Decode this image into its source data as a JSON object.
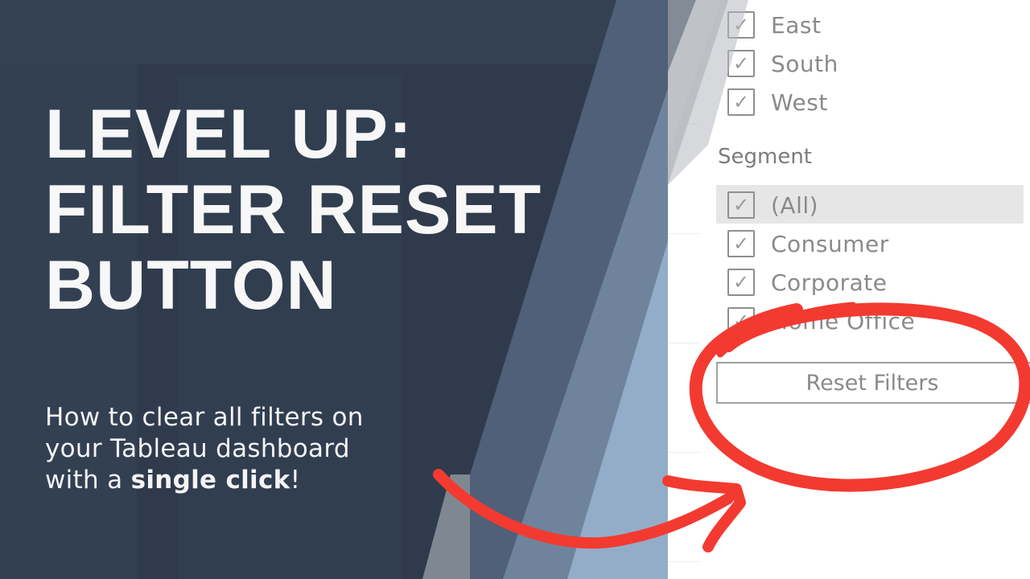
{
  "headline": {
    "lines": [
      "LEVEL UP:",
      "FILTER RESET",
      "BUTTON"
    ]
  },
  "subtitle": {
    "line1": "How to clear all filters on",
    "line2": "your Tableau dashboard",
    "line3_prefix": "with a ",
    "line3_bold": "single click",
    "line3_suffix": "!"
  },
  "region_filter": {
    "items": [
      {
        "label": "East",
        "checked": true
      },
      {
        "label": "South",
        "checked": true
      },
      {
        "label": "West",
        "checked": true
      }
    ]
  },
  "segment_filter": {
    "title": "Segment",
    "items": [
      {
        "label": "(All)",
        "checked": true,
        "highlighted": true
      },
      {
        "label": "Consumer",
        "checked": true
      },
      {
        "label": "Corporate",
        "checked": true
      },
      {
        "label": "Home Office",
        "checked": true
      }
    ]
  },
  "reset_button": {
    "label": "Reset Filters"
  },
  "icons": {
    "checkmark": "✓"
  },
  "colors": {
    "background_dark": "#2f3b4c",
    "stripe_mid": "#4f6078",
    "stripe_light": "#6f849c",
    "stripe_pale": "#93adc9",
    "stripe_grey": "#bfc2c6",
    "annotation_red": "#f33a30",
    "text_light": "#f7f7f7"
  }
}
